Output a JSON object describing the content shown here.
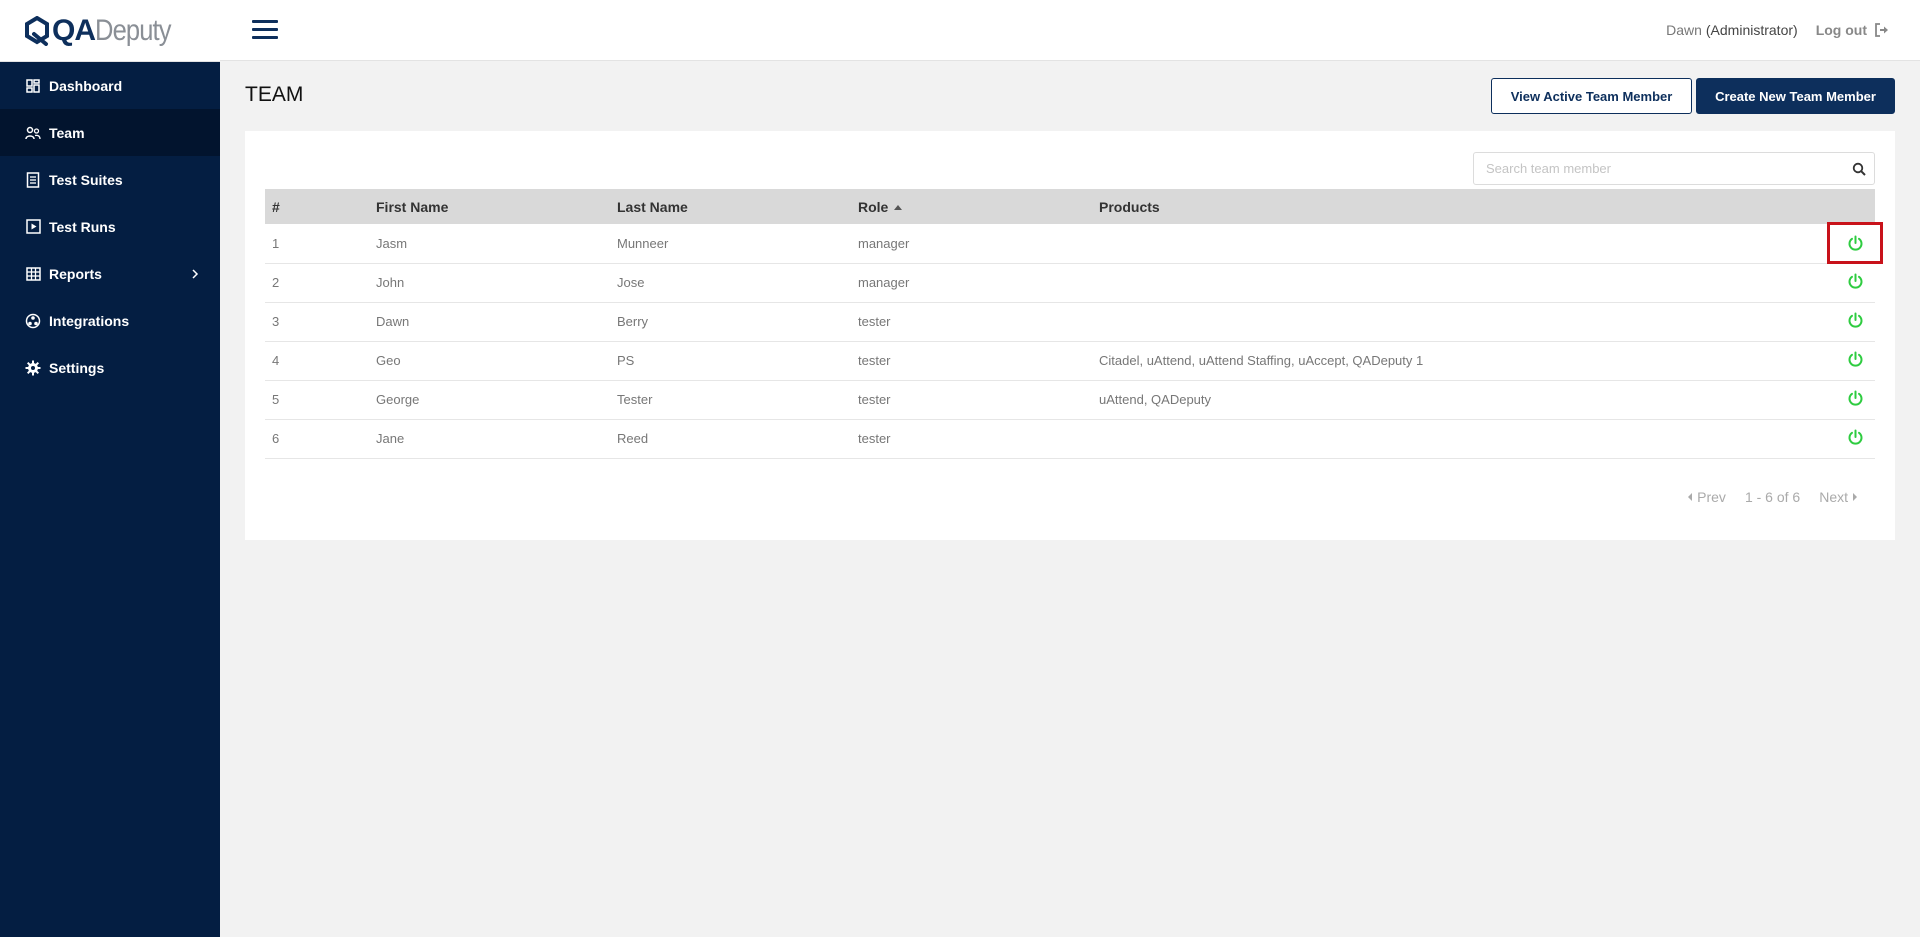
{
  "brand": {
    "name_part1": "QA",
    "name_part2": "Deputy",
    "accent": "#0d2f5c",
    "sidebar_bg": "#041e42"
  },
  "sidebar": {
    "items": [
      {
        "label": "Dashboard",
        "icon": "dashboard-grid-icon",
        "active": false
      },
      {
        "label": "Team",
        "icon": "team-users-icon",
        "active": true
      },
      {
        "label": "Test Suites",
        "icon": "test-suites-icon",
        "active": false
      },
      {
        "label": "Test Runs",
        "icon": "test-runs-icon",
        "active": false
      },
      {
        "label": "Reports",
        "icon": "reports-table-icon",
        "active": false,
        "has_submenu": true
      },
      {
        "label": "Integrations",
        "icon": "integrations-icon",
        "active": false
      },
      {
        "label": "Settings",
        "icon": "settings-gear-icon",
        "active": false
      }
    ]
  },
  "header": {
    "user_name": "Dawn",
    "user_role": "(Administrator)",
    "logout_label": "Log out"
  },
  "page": {
    "title": "TEAM",
    "view_active_label": "View Active Team Member",
    "create_new_label": "Create New Team Member"
  },
  "search": {
    "placeholder": "Search team member",
    "value": ""
  },
  "table": {
    "columns": [
      "#",
      "First Name",
      "Last Name",
      "Role",
      "Products"
    ],
    "sorted_column": "Role",
    "rows": [
      {
        "num": "1",
        "first": "Jasm",
        "last": "Munneer",
        "role": "manager",
        "products": "",
        "active": true,
        "highlighted": true
      },
      {
        "num": "2",
        "first": "John",
        "last": "Jose",
        "role": "manager",
        "products": "",
        "active": true
      },
      {
        "num": "3",
        "first": "Dawn",
        "last": "Berry",
        "role": "tester",
        "products": "",
        "active": true
      },
      {
        "num": "4",
        "first": "Geo",
        "last": "PS",
        "role": "tester",
        "products": "Citadel, uAttend, uAttend Staffing, uAccept, QADeputy 1",
        "active": true
      },
      {
        "num": "5",
        "first": "George",
        "last": "Tester",
        "role": "tester",
        "products": "uAttend, QADeputy",
        "active": true
      },
      {
        "num": "6",
        "first": "Jane",
        "last": "Reed",
        "role": "tester",
        "products": "",
        "active": true
      }
    ],
    "power_color": "#2ecc40",
    "highlight_color": "#c8121a"
  },
  "pagination": {
    "prev_label": "Prev",
    "range_label": "1 - 6 of 6",
    "next_label": "Next"
  }
}
